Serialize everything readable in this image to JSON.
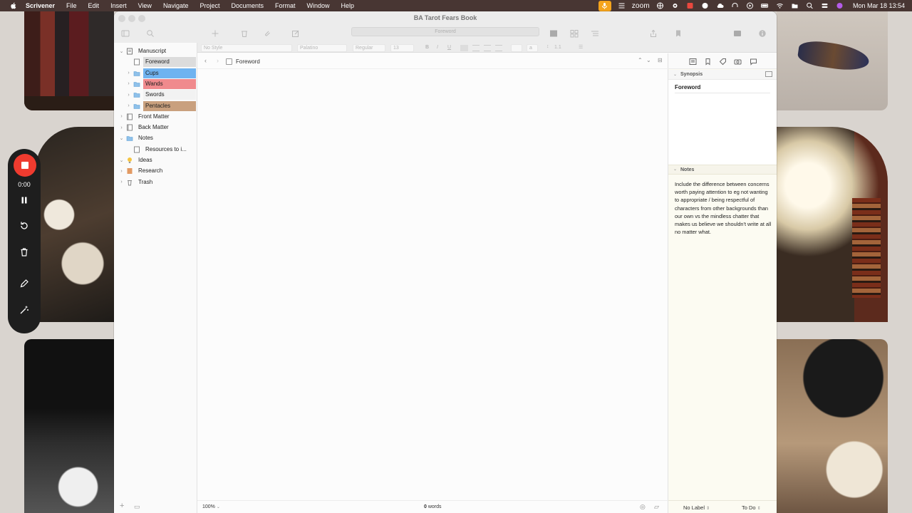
{
  "menubar": {
    "app": "Scrivener",
    "menus": [
      "File",
      "Edit",
      "Insert",
      "View",
      "Navigate",
      "Project",
      "Documents",
      "Format",
      "Window",
      "Help"
    ],
    "zoom_label": "zoom",
    "clock": "Mon Mar 18  13:54"
  },
  "recorder": {
    "time": "0:00"
  },
  "window": {
    "title": "BA Tarot Fears Book",
    "path_field": "Foreword"
  },
  "formatbar": {
    "style": "No Style",
    "font": "Palatino",
    "weight": "Regular",
    "size": "13",
    "bold": "B",
    "italic": "I",
    "underline": "U",
    "text_color": "a",
    "line_spacing": "1.1"
  },
  "binder": {
    "items": [
      {
        "label": "Manuscript",
        "icon": "manuscript-icon",
        "disclosure": "down"
      },
      {
        "label": "Foreword",
        "icon": "document-icon",
        "disclosure": ""
      },
      {
        "label": "Cups",
        "icon": "folder-icon",
        "disclosure": "right"
      },
      {
        "label": "Wands",
        "icon": "folder-icon",
        "disclosure": "right"
      },
      {
        "label": "Swords",
        "icon": "folder-icon",
        "disclosure": "right"
      },
      {
        "label": "Pentacles",
        "icon": "folder-icon",
        "disclosure": "right"
      },
      {
        "label": "Front Matter",
        "icon": "book-icon",
        "disclosure": "right"
      },
      {
        "label": "Back Matter",
        "icon": "book-icon",
        "disclosure": "right"
      },
      {
        "label": "Notes",
        "icon": "folder-icon",
        "disclosure": "down"
      },
      {
        "label": "Resources to i...",
        "icon": "document-icon",
        "disclosure": ""
      },
      {
        "label": "Ideas",
        "icon": "lightbulb-icon",
        "disclosure": "down"
      },
      {
        "label": "Research",
        "icon": "research-icon",
        "disclosure": "right"
      },
      {
        "label": "Trash",
        "icon": "trash-icon",
        "disclosure": "right"
      }
    ],
    "label_colors": {
      "Foreword": "#dcdcdc",
      "Cups": "#6fb3f0",
      "Wands": "#f08a8d",
      "Swords": "#f2f2f2",
      "Pentacles": "#c9a07e"
    }
  },
  "editor": {
    "doc_title": "Foreword",
    "zoom": "100%",
    "word_count": "0",
    "word_unit": "words"
  },
  "inspector": {
    "synopsis_header": "Synopsis",
    "synopsis_title": "Foreword",
    "notes_header": "Notes",
    "notes_text": "Include the difference between concerns worth paying attention to eg not wanting to appropriate / being respectful of characters from other backgrounds than our own vs the mindless chatter that makes us believe we shouldn't write at all no matter what.",
    "label_select": "No Label",
    "status_select": "To Do"
  }
}
